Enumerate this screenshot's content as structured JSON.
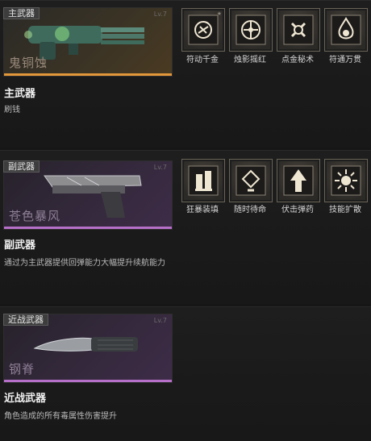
{
  "sections": [
    {
      "tag": "主武器",
      "weapon_name": "鬼铜蚀",
      "card_level": "Lv.7",
      "title": "主武器",
      "description": "刷钱",
      "skills": [
        {
          "label": "符动千金",
          "icon": "coin-chip-icon"
        },
        {
          "label": "烛影摇红",
          "icon": "candle-shadow-icon"
        },
        {
          "label": "点金秘术",
          "icon": "golden-touch-icon"
        },
        {
          "label": "符通万贯",
          "icon": "talisman-fortune-icon"
        }
      ]
    },
    {
      "tag": "副武器",
      "weapon_name": "苍色暴风",
      "card_level": "Lv.7",
      "title": "副武器",
      "description": "通过为主武器提供回弹能力大幅提升续航能力",
      "skills": [
        {
          "label": "狂暴装填",
          "icon": "frenzy-reload-icon"
        },
        {
          "label": "随时待命",
          "icon": "standby-icon"
        },
        {
          "label": "伏击弹药",
          "icon": "ambush-ammo-icon"
        },
        {
          "label": "技能扩散",
          "icon": "skill-spread-icon"
        }
      ]
    },
    {
      "tag": "近战武器",
      "weapon_name": "钢脊",
      "card_level": "Lv.7",
      "title": "近战武器",
      "description": "角色造成的所有毒属性伤害提升",
      "skills": []
    }
  ],
  "colors": {
    "gold_rarity": "#e1973a",
    "purple_rarity": "#b770c9"
  }
}
